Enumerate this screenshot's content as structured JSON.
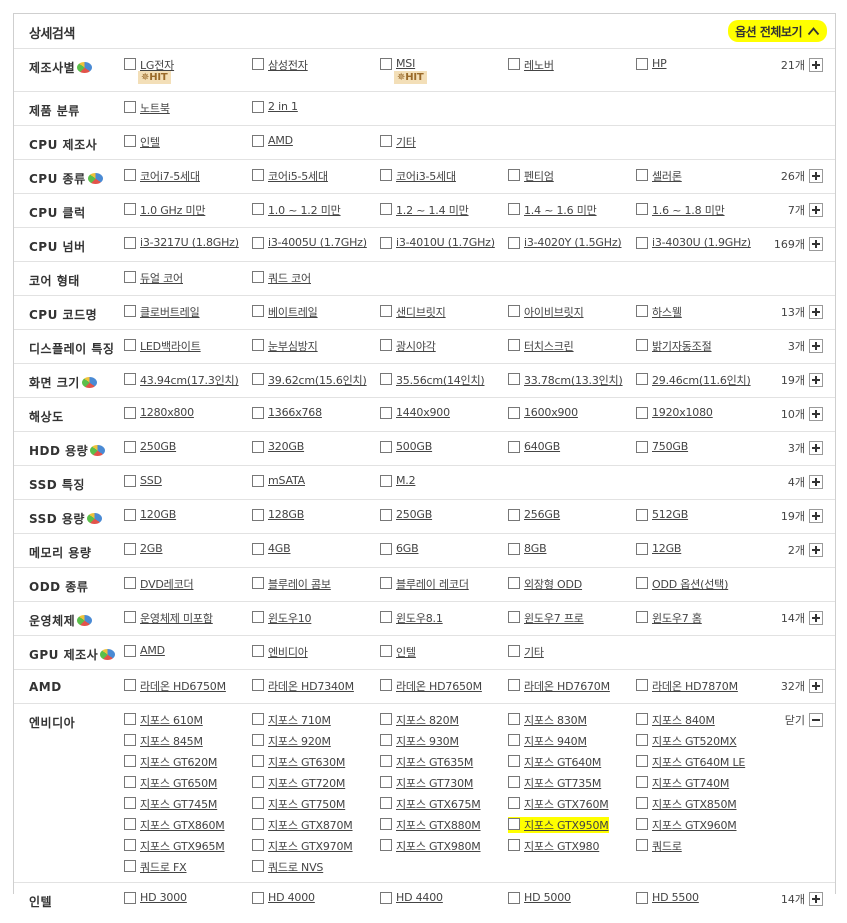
{
  "header": {
    "title": "상세검색",
    "toggle_label": "옵션 전체보기"
  },
  "rows": [
    {
      "label": "제조사별",
      "pie": true,
      "count": "21개",
      "btn": "plus",
      "options": [
        {
          "t": "LG전자",
          "hit": "HIT"
        },
        {
          "t": "삼성전자"
        },
        {
          "t": "MSI",
          "hit": "HIT"
        },
        {
          "t": "레노버"
        },
        {
          "t": "HP"
        }
      ]
    },
    {
      "label": "제품 분류",
      "options": [
        {
          "t": "노트북"
        },
        {
          "t": "2 in 1"
        }
      ]
    },
    {
      "label": "CPU 제조사",
      "options": [
        {
          "t": "인텔"
        },
        {
          "t": "AMD"
        },
        {
          "t": "기타"
        }
      ]
    },
    {
      "label": "CPU 종류",
      "pie": true,
      "count": "26개",
      "btn": "plus",
      "options": [
        {
          "t": "코어i7-5세대"
        },
        {
          "t": "코어i5-5세대"
        },
        {
          "t": "코어i3-5세대"
        },
        {
          "t": "펜티엄"
        },
        {
          "t": "셀러론"
        }
      ]
    },
    {
      "label": "CPU 클럭",
      "count": "7개",
      "btn": "plus",
      "options": [
        {
          "t": "1.0 GHz 미만"
        },
        {
          "t": "1.0 ~ 1.2 미만"
        },
        {
          "t": "1.2 ~ 1.4 미만"
        },
        {
          "t": "1.4 ~ 1.6 미만"
        },
        {
          "t": "1.6 ~ 1.8 미만"
        }
      ]
    },
    {
      "label": "CPU 넘버",
      "count": "169개",
      "btn": "plus",
      "options": [
        {
          "t": "i3-3217U (1.8GHz)"
        },
        {
          "t": "i3-4005U (1.7GHz)"
        },
        {
          "t": "i3-4010U (1.7GHz)"
        },
        {
          "t": "i3-4020Y (1.5GHz)"
        },
        {
          "t": "i3-4030U (1.9GHz)"
        }
      ]
    },
    {
      "label": "코어 형태",
      "options": [
        {
          "t": "듀얼 코어"
        },
        {
          "t": "쿼드 코어"
        }
      ]
    },
    {
      "label": "CPU 코드명",
      "count": "13개",
      "btn": "plus",
      "options": [
        {
          "t": "클로버트레일"
        },
        {
          "t": "베이트레일"
        },
        {
          "t": "샌디브릿지"
        },
        {
          "t": "아이비브릿지"
        },
        {
          "t": "하스웰"
        }
      ]
    },
    {
      "label": "디스플레이 특징",
      "count": "3개",
      "btn": "plus",
      "options": [
        {
          "t": "LED백라이트"
        },
        {
          "t": "눈부심방지"
        },
        {
          "t": "광시야각"
        },
        {
          "t": "터치스크린"
        },
        {
          "t": "밝기자동조절"
        }
      ]
    },
    {
      "label": "화면 크기",
      "pie": true,
      "count": "19개",
      "btn": "plus",
      "options": [
        {
          "t": "43.94cm(17.3인치)"
        },
        {
          "t": "39.62cm(15.6인치)"
        },
        {
          "t": "35.56cm(14인치)"
        },
        {
          "t": "33.78cm(13.3인치)"
        },
        {
          "t": "29.46cm(11.6인치)"
        }
      ]
    },
    {
      "label": "해상도",
      "count": "10개",
      "btn": "plus",
      "options": [
        {
          "t": "1280x800"
        },
        {
          "t": "1366x768"
        },
        {
          "t": "1440x900"
        },
        {
          "t": "1600x900"
        },
        {
          "t": "1920x1080"
        }
      ]
    },
    {
      "label": "HDD 용량",
      "pie": true,
      "count": "3개",
      "btn": "plus",
      "options": [
        {
          "t": "250GB"
        },
        {
          "t": "320GB"
        },
        {
          "t": "500GB"
        },
        {
          "t": "640GB"
        },
        {
          "t": "750GB"
        }
      ]
    },
    {
      "label": "SSD 특징",
      "count": "4개",
      "btn": "plus",
      "options": [
        {
          "t": "SSD"
        },
        {
          "t": "mSATA"
        },
        {
          "t": "M.2"
        }
      ]
    },
    {
      "label": "SSD 용량",
      "pie": true,
      "count": "19개",
      "btn": "plus",
      "options": [
        {
          "t": "120GB"
        },
        {
          "t": "128GB"
        },
        {
          "t": "250GB"
        },
        {
          "t": "256GB"
        },
        {
          "t": "512GB"
        }
      ]
    },
    {
      "label": "메모리 용량",
      "count": "2개",
      "btn": "plus",
      "options": [
        {
          "t": "2GB"
        },
        {
          "t": "4GB"
        },
        {
          "t": "6GB"
        },
        {
          "t": "8GB"
        },
        {
          "t": "12GB"
        }
      ]
    },
    {
      "label": "ODD 종류",
      "options": [
        {
          "t": "DVD레코더"
        },
        {
          "t": "블루레이 콤보"
        },
        {
          "t": "블루레이 레코더"
        },
        {
          "t": "외장형 ODD"
        },
        {
          "t": "ODD 옵션(선택)"
        }
      ]
    },
    {
      "label": "운영체제",
      "pie": true,
      "count": "14개",
      "btn": "plus",
      "options": [
        {
          "t": "운영체제 미포함"
        },
        {
          "t": "윈도우10"
        },
        {
          "t": "윈도우8.1"
        },
        {
          "t": "윈도우7 프로"
        },
        {
          "t": "윈도우7 홈"
        }
      ]
    },
    {
      "label": "GPU 제조사",
      "pie": true,
      "options": [
        {
          "t": "AMD"
        },
        {
          "t": "엔비디아"
        },
        {
          "t": "인텔"
        },
        {
          "t": "기타"
        }
      ]
    },
    {
      "label": "AMD",
      "count": "32개",
      "btn": "plus",
      "options": [
        {
          "t": "라데온 HD6750M"
        },
        {
          "t": "라데온 HD7340M"
        },
        {
          "t": "라데온 HD7650M"
        },
        {
          "t": "라데온 HD7670M"
        },
        {
          "t": "라데온 HD7870M"
        }
      ]
    },
    {
      "label": "엔비디아",
      "count": "닫기",
      "btn": "minus",
      "options": [
        {
          "t": "지포스 610M"
        },
        {
          "t": "지포스 710M"
        },
        {
          "t": "지포스 820M"
        },
        {
          "t": "지포스 830M"
        },
        {
          "t": "지포스 840M"
        },
        {
          "t": "지포스 845M"
        },
        {
          "t": "지포스 920M"
        },
        {
          "t": "지포스 930M"
        },
        {
          "t": "지포스 940M"
        },
        {
          "t": "지포스 GT520MX"
        },
        {
          "t": "지포스 GT620M"
        },
        {
          "t": "지포스 GT630M"
        },
        {
          "t": "지포스 GT635M"
        },
        {
          "t": "지포스 GT640M"
        },
        {
          "t": "지포스 GT640M LE"
        },
        {
          "t": "지포스 GT650M"
        },
        {
          "t": "지포스 GT720M"
        },
        {
          "t": "지포스 GT730M"
        },
        {
          "t": "지포스 GT735M"
        },
        {
          "t": "지포스 GT740M"
        },
        {
          "t": "지포스 GT745M"
        },
        {
          "t": "지포스 GT750M"
        },
        {
          "t": "지포스 GTX675M"
        },
        {
          "t": "지포스 GTX760M"
        },
        {
          "t": "지포스 GTX850M"
        },
        {
          "t": "지포스 GTX860M"
        },
        {
          "t": "지포스 GTX870M"
        },
        {
          "t": "지포스 GTX880M"
        },
        {
          "t": "지포스 GTX950M",
          "highlight": true
        },
        {
          "t": "지포스 GTX960M"
        },
        {
          "t": "지포스 GTX965M"
        },
        {
          "t": "지포스 GTX970M"
        },
        {
          "t": "지포스 GTX980M"
        },
        {
          "t": "지포스 GTX980"
        },
        {
          "t": "쿼드로"
        },
        {
          "t": "쿼드로 FX"
        },
        {
          "t": "쿼드로 NVS"
        }
      ]
    },
    {
      "label": "인텔",
      "count": "14개",
      "btn": "plus",
      "options": [
        {
          "t": "HD 3000"
        },
        {
          "t": "HD 4000"
        },
        {
          "t": "HD 4400"
        },
        {
          "t": "HD 5000"
        },
        {
          "t": "HD 5500"
        }
      ]
    }
  ]
}
